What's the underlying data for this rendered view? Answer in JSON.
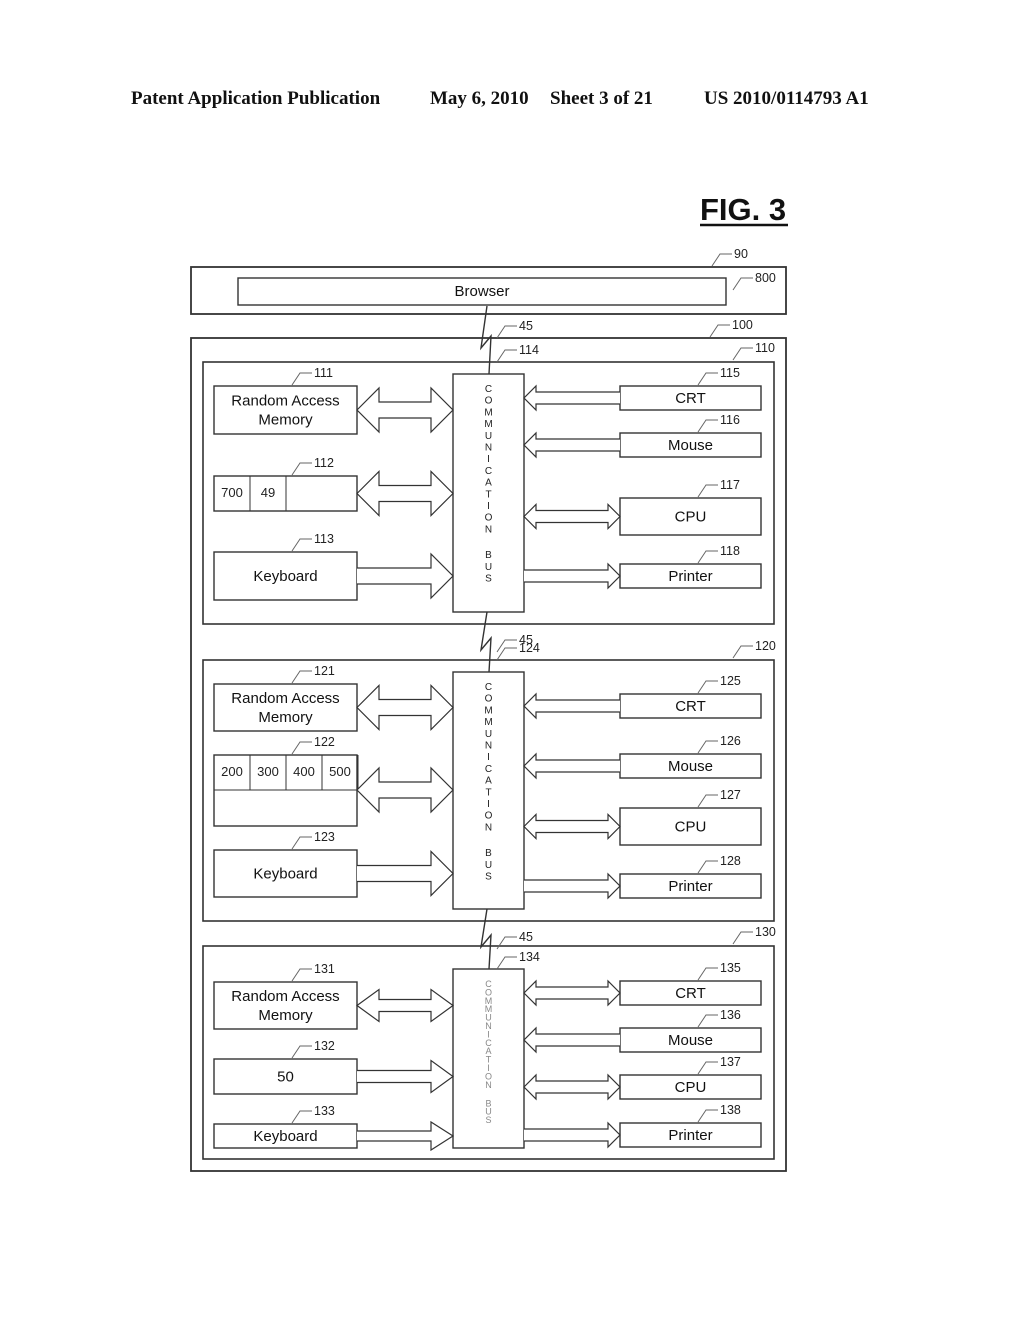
{
  "header": {
    "publication": "Patent Application Publication",
    "date": "May 6, 2010",
    "sheet": "Sheet 3 of 21",
    "number": "US 2010/0114793 A1"
  },
  "figure": {
    "title": "FIG. 3",
    "outer_box": {
      "ref": "90",
      "browser": {
        "label": "Browser",
        "ref": "800"
      }
    },
    "system_box": {
      "ref": "100"
    },
    "network_ref": "45",
    "bus_text": "COMMUNICATION BUS",
    "computers": [
      {
        "ref": "110",
        "bus_ref": "114",
        "left": [
          {
            "ref": "111",
            "label": "Random Access Memory",
            "arrow": "bidirectional"
          },
          {
            "ref": "112",
            "cells": [
              "700",
              "49",
              ""
            ],
            "arrow": "bidirectional"
          },
          {
            "ref": "113",
            "label": "Keyboard",
            "arrow": "to-bus"
          }
        ],
        "right": [
          {
            "ref": "115",
            "label": "CRT",
            "arrow": "to-bus"
          },
          {
            "ref": "116",
            "label": "Mouse",
            "arrow": "to-bus"
          },
          {
            "ref": "117",
            "label": "CPU",
            "arrow": "bidirectional"
          },
          {
            "ref": "118",
            "label": "Printer",
            "arrow": "from-bus"
          }
        ]
      },
      {
        "ref": "120",
        "bus_ref": "124",
        "left": [
          {
            "ref": "121",
            "label": "Random Access Memory",
            "arrow": "bidirectional"
          },
          {
            "ref": "122",
            "cells": [
              "200",
              "300",
              "400",
              "500"
            ],
            "arrow": "bidirectional"
          },
          {
            "ref": "123",
            "label": "Keyboard",
            "arrow": "to-bus"
          }
        ],
        "right": [
          {
            "ref": "125",
            "label": "CRT",
            "arrow": "to-bus"
          },
          {
            "ref": "126",
            "label": "Mouse",
            "arrow": "to-bus"
          },
          {
            "ref": "127",
            "label": "CPU",
            "arrow": "bidirectional"
          },
          {
            "ref": "128",
            "label": "Printer",
            "arrow": "from-bus"
          }
        ]
      },
      {
        "ref": "130",
        "bus_ref": "134",
        "left": [
          {
            "ref": "131",
            "label": "Random Access Memory",
            "arrow": "bidirectional"
          },
          {
            "ref": "132",
            "label": "50",
            "arrow": "to-bus"
          },
          {
            "ref": "133",
            "label": "Keyboard",
            "arrow": "to-bus"
          }
        ],
        "right": [
          {
            "ref": "135",
            "label": "CRT",
            "arrow": "bidirectional"
          },
          {
            "ref": "136",
            "label": "Mouse",
            "arrow": "to-bus"
          },
          {
            "ref": "137",
            "label": "CPU",
            "arrow": "bidirectional"
          },
          {
            "ref": "138",
            "label": "Printer",
            "arrow": "from-bus"
          }
        ]
      }
    ]
  }
}
